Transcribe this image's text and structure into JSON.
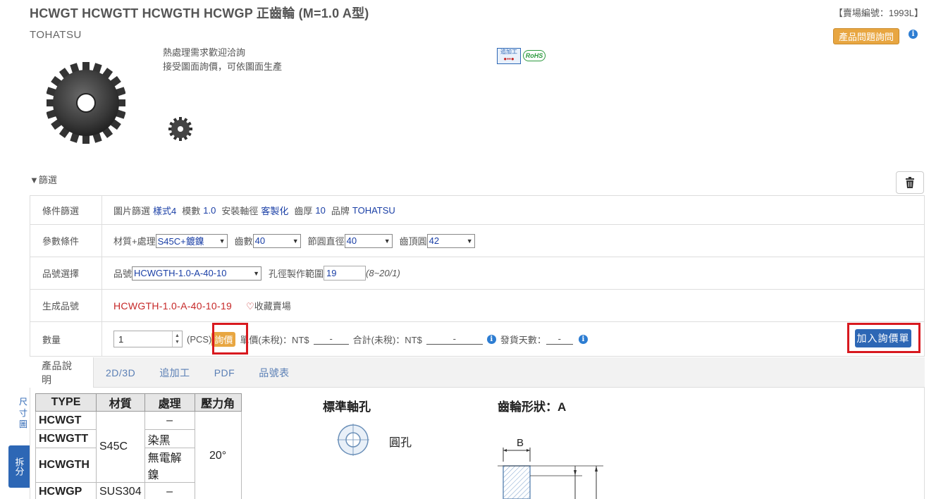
{
  "header": {
    "title": "HCWGT HCWGTT HCWGTH HCWGP 正齒輪 (M=1.0 A型)",
    "store_code": "【賣場編號：1993L】",
    "brand": "TOHATSU",
    "inquiry_button": "產品問題詢問"
  },
  "notes": {
    "line1": "熱處理需求歡迎洽詢",
    "line2": "接受圖面詢價，可依圖面生產"
  },
  "badges": {
    "addproc": "追加工",
    "rohs": "RoHS"
  },
  "filter": {
    "toggle_label": "▼篩選"
  },
  "spec": {
    "row1": {
      "label": "條件篩選",
      "img_label": "圖片篩選",
      "img_value": "樣式4",
      "module_label": "模數",
      "module_value": "1.0",
      "shaft_label": "安裝軸徑",
      "shaft_value": "客製化",
      "thick_label": "齒厚",
      "thick_value": "10",
      "brand_label": "品牌",
      "brand_value": "TOHATSU"
    },
    "row2": {
      "label": "參數條件",
      "material_label": "材質+處理",
      "material_value": "S45C+鍍鎳",
      "teeth_label": "齒數",
      "teeth_value": "40",
      "pitch_label": "節圓直徑",
      "pitch_value": "40",
      "tip_label": "齒頂圓",
      "tip_value": "42"
    },
    "row3": {
      "label": "品號選擇",
      "part_label": "品號",
      "part_value": "HCWGTH-1.0-A-40-10",
      "bore_label": "孔徑製作範圍",
      "bore_value": "19",
      "bore_range": "(8~20/1)"
    },
    "row4": {
      "label": "生成品號",
      "generated": "HCWGTH-1.0-A-40-10-19",
      "favorite": "收藏賣場"
    },
    "row5": {
      "label": "數量",
      "qty": "1",
      "unit": "(PCS)",
      "price_btn": "詢價",
      "unit_price_label": "單價(未稅)：NT$",
      "unit_price_value": "-",
      "total_label": "合計(未稅)：NT$",
      "total_value": "-",
      "ship_label": "發貨天數：",
      "ship_value": "-",
      "cart_btn": "加入詢價單"
    }
  },
  "tabs": [
    "產品說明",
    "2D/3D",
    "追加工",
    "PDF",
    "品號表"
  ],
  "side": {
    "dim": "尺寸圖",
    "split": "拆分"
  },
  "type_table": {
    "headers": [
      "TYPE",
      "材質",
      "處理",
      "壓力角"
    ],
    "types": [
      "HCWGT",
      "HCWGTT",
      "HCWGTH",
      "HCWGP"
    ],
    "mat_s45c": "S45C",
    "mat_sus": "SUS304",
    "treat": [
      "–",
      "染黑",
      "無電解鎳",
      "–"
    ],
    "pressure_angle": "20°"
  },
  "sections": {
    "bore_title": "標準軸孔",
    "round_hole": "圓孔",
    "shape_title": "齒輪形狀：A",
    "dim_b": "B"
  },
  "colors": {
    "accent_blue": "#2d67b5",
    "orange": "#e8a641",
    "red": "#d8191f",
    "part_red": "#c62828"
  }
}
